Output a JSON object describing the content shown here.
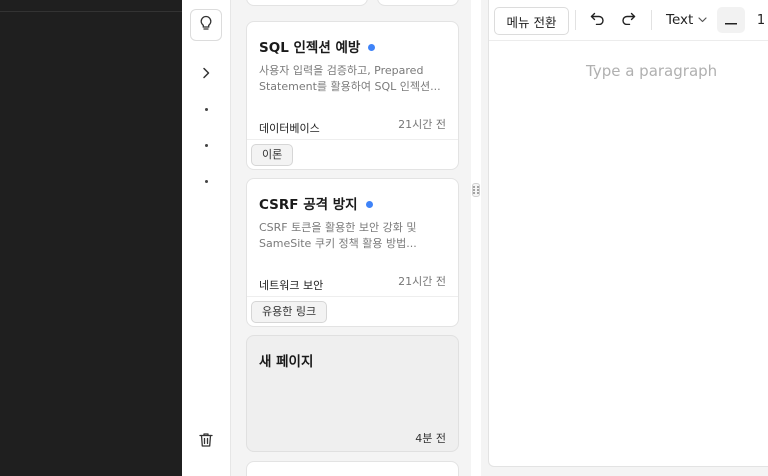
{
  "cards": [
    {
      "title": "SQL 인젝션 예방",
      "desc_line1": "사용자 입력을 검증하고, Prepared",
      "desc_line2": "Statement를 활용하여 SQL 인젝션...",
      "category": "데이터베이스",
      "time": "21시간 전",
      "tag": "이론",
      "unread": true
    },
    {
      "title": "CSRF 공격 방지",
      "desc_line1": "CSRF 토큰을 활용한 보안 강화 및",
      "desc_line2": "SameSite 쿠키 정책 활용 방법...",
      "category": "네트워크 보안",
      "time": "21시간 전",
      "tag": "유용한 링크",
      "unread": true
    },
    {
      "title": "새 페이지",
      "time": "4분 전"
    }
  ],
  "toolbar": {
    "menu_toggle_label": "메뉴 전환",
    "text_style_label": "Text",
    "font_size_value": "1"
  },
  "editor": {
    "placeholder": "Type a paragraph"
  },
  "icons": {
    "bulb": "lightbulb-icon",
    "expand": "chevron-right-icon",
    "trash": "trash-icon",
    "undo": "undo-icon",
    "redo": "redo-icon",
    "drag": "drag-handle-icon"
  },
  "colors": {
    "accent_dot": "#3f83f8",
    "dark_panel": "#1f1f1f"
  }
}
